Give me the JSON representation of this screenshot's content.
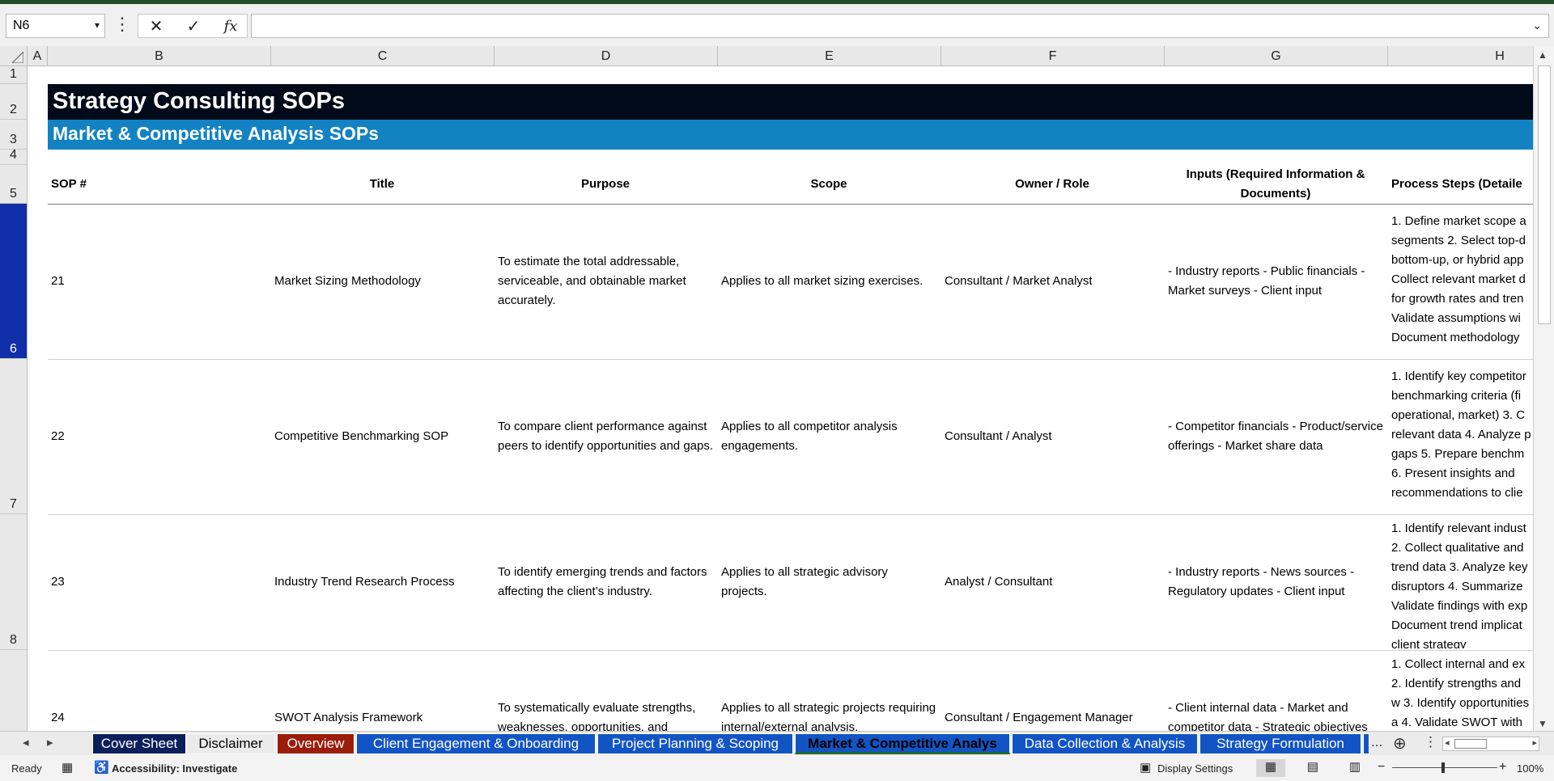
{
  "formula_bar": {
    "name_box": "N6",
    "formula": "",
    "cancel_icon": "✕",
    "enter_icon": "✓",
    "fx_label": "fx"
  },
  "columns": [
    "A",
    "B",
    "C",
    "D",
    "E",
    "F",
    "G",
    "H"
  ],
  "rows": [
    "1",
    "2",
    "3",
    "4",
    "5",
    "6",
    "7",
    "8"
  ],
  "sheet": {
    "title": "Strategy Consulting SOPs",
    "subtitle": "Market & Competitive Analysis SOPs",
    "headers": {
      "sop": "SOP #",
      "title": "Title",
      "purpose": "Purpose",
      "scope": "Scope",
      "owner": "Owner / Role",
      "inputs": "Inputs (Required Information & Documents)",
      "steps": "Process Steps (Detaile"
    },
    "records": [
      {
        "sop": "21",
        "title": "Market Sizing Methodology",
        "purpose": "To estimate the total addressable, serviceable, and obtainable market accurately.",
        "scope": "Applies to all market sizing exercises.",
        "owner": "Consultant / Market Analyst",
        "inputs": "- Industry reports - Public financials - Market surveys - Client input",
        "steps": "1. Define market scope a segments 2. Select top-d bottom-up, or hybrid app Collect relevant market d for growth rates and tren Validate assumptions wi Document methodology"
      },
      {
        "sop": "22",
        "title": "Competitive Benchmarking SOP",
        "purpose": "To compare client performance against peers to identify opportunities and gaps.",
        "scope": "Applies to all competitor analysis engagements.",
        "owner": "Consultant / Analyst",
        "inputs": "- Competitor financials - Product/service offerings - Market share data",
        "steps": "1. Identify key competitor benchmarking criteria (fi operational, market) 3. C relevant data 4. Analyze p gaps 5. Prepare benchm 6. Present insights and recommendations to clie"
      },
      {
        "sop": "23",
        "title": "Industry Trend Research Process",
        "purpose": "To identify emerging trends and factors affecting the client’s industry.",
        "scope": "Applies to all strategic advisory projects.",
        "owner": "Analyst / Consultant",
        "inputs": "- Industry reports - News sources - Regulatory updates - Client input",
        "steps": "1. Identify relevant indust 2. Collect qualitative and trend data 3. Analyze key disruptors 4. Summarize Validate findings with exp Document trend implicat client strategy"
      },
      {
        "sop": "24",
        "title": "SWOT Analysis Framework",
        "purpose": "To systematically evaluate strengths, weaknesses, opportunities, and",
        "scope": "Applies to all strategic projects requiring internal/external analysis.",
        "owner": "Consultant / Engagement Manager",
        "inputs": "- Client internal data - Market and competitor data - Strategic objectives",
        "steps": "1. Collect internal and ex 2. Identify strengths and w 3. Identify opportunities a 4. Validate SWOT with st"
      }
    ]
  },
  "tabs": [
    {
      "label": "Cover Sheet",
      "color": "#0b1f5c"
    },
    {
      "label": "Disclaimer",
      "color": "#ebebeb"
    },
    {
      "label": "Overview",
      "color": "#9c1c0c"
    },
    {
      "label": "Client Engagement & Onboarding",
      "color": "#1354c4"
    },
    {
      "label": "Project Planning & Scoping",
      "color": "#1354c4"
    },
    {
      "label": "Market & Competitive Analys",
      "color": "#1354c4"
    },
    {
      "label": "Data Collection & Analysis",
      "color": "#1354c4"
    },
    {
      "label": "Strategy Formulation",
      "color": "#1354c4"
    }
  ],
  "tab_more": "...",
  "status": {
    "ready": "Ready",
    "accessibility": "Accessibility: Investigate",
    "display_settings": "Display Settings",
    "zoom": "100%",
    "zoom_minus": "−",
    "zoom_plus": "+"
  }
}
